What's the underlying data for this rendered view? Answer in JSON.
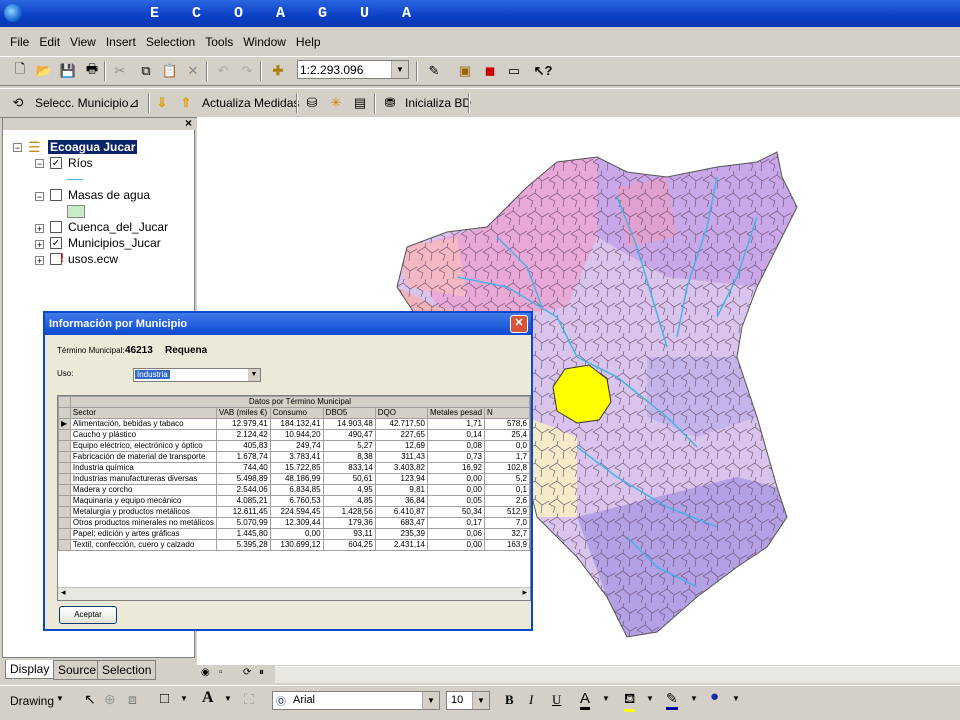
{
  "app": {
    "title": "E C O A G U A"
  },
  "menu": [
    "File",
    "Edit",
    "View",
    "Insert",
    "Selection",
    "Tools",
    "Window",
    "Help"
  ],
  "toolbar1": {
    "scale": "1:2.293.096"
  },
  "toolbar2": {
    "selecc_label": "Selecc. Municipio",
    "actualiza_label": "Actualiza Medidas",
    "inicializa_label": "Inicializa BD"
  },
  "toc": {
    "root": "Ecoagua Jucar",
    "layers": [
      {
        "label": "Ríos",
        "checked": "✓"
      },
      {
        "label": "Masas de agua",
        "checked": ""
      },
      {
        "label": "Cuenca_del_Jucar",
        "checked": ""
      },
      {
        "label": "Municipios_Jucar",
        "checked": "✓"
      },
      {
        "label": "usos.ecw",
        "checked": ""
      }
    ],
    "close": "×"
  },
  "tabs": [
    "Display",
    "Source",
    "Selection"
  ],
  "dialog": {
    "title": "Información por Municipio",
    "termino_label": "Término Municipal:",
    "termino_code": "46213",
    "termino_name": "Requena",
    "uso_label": "Uso:",
    "uso_value": "Industria",
    "group_header": "Datos por Término Municipal",
    "columns": [
      "Sector",
      "VAB (miles €)",
      "Consumo",
      "DBO5",
      "DQO",
      "Metales pesad",
      "N"
    ],
    "rows": [
      [
        "Alimentación, bebidas y tabaco",
        "12.979,41",
        "184.132,41",
        "14.903,48",
        "42.717,50",
        "1,71",
        "578,6"
      ],
      [
        "Caucho y plástico",
        "2.124,42",
        "10.944,20",
        "490,47",
        "227,65",
        "0,14",
        "25,4"
      ],
      [
        "Equipo eléctrico, electrónico y óptico",
        "405,83",
        "249,74",
        "5,27",
        "12,69",
        "0,08",
        "0,0"
      ],
      [
        "Fabricación de material de transporte",
        "1.678,74",
        "3.783,41",
        "8,38",
        "311,43",
        "0,73",
        "1,7"
      ],
      [
        "Industria química",
        "744,40",
        "15.722,85",
        "833,14",
        "3.403,82",
        "16,92",
        "102,8"
      ],
      [
        "Industrias manufactureras diversas",
        "5.498,89",
        "48.186,99",
        "50,61",
        "123,94",
        "0,00",
        "5,2"
      ],
      [
        "Madera y corcho",
        "2.544,06",
        "6.834,85",
        "4,95",
        "9,81",
        "0,00",
        "0,1"
      ],
      [
        "Maquinaria y equipo mecánico",
        "4.085,21",
        "6.760,53",
        "4,85",
        "36,84",
        "0,05",
        "2,6"
      ],
      [
        "Metalurgia y productos metálicos",
        "12.611,45",
        "224.594,45",
        "1.428,56",
        "6.410,87",
        "50,34",
        "512,9"
      ],
      [
        "Otros productos minerales no metálicos",
        "5.070,99",
        "12.309,44",
        "179,36",
        "683,47",
        "0,17",
        "7,0"
      ],
      [
        "Papel; edición y artes gráficas",
        "1.445,80",
        "0,00",
        "93,11",
        "235,39",
        "0,06",
        "32,7"
      ],
      [
        "Textil, confección, cuero y calzado",
        "5.395,28",
        "130.699,12",
        "604,25",
        "2.431,14",
        "0,00",
        "163,9"
      ]
    ],
    "accept_label": "Aceptar"
  },
  "drawbar": {
    "drawing_label": "Drawing",
    "font": "Arial",
    "font_size": "10",
    "bold": "B",
    "italic": "I",
    "underline": "U",
    "text_tool": "A"
  },
  "colors": {
    "title_blue": "#0a3fc4",
    "selected_municipio": "#ffff00",
    "rivers": "#3cb4e6"
  }
}
